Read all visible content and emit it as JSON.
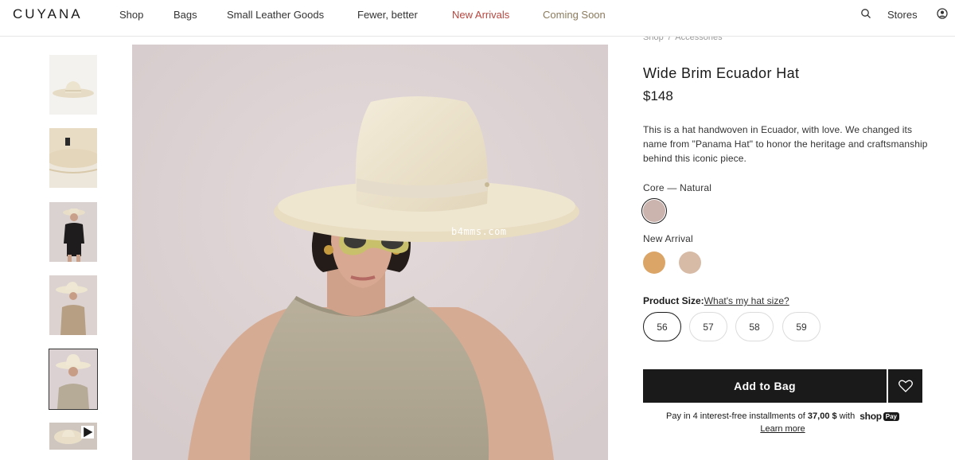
{
  "header": {
    "logo": "CUYANA",
    "nav": [
      "Shop",
      "Bags",
      "Small Leather Goods",
      "Fewer, better",
      "New Arrivals",
      "Coming Soon"
    ],
    "stores": "Stores"
  },
  "breadcrumb": [
    "Shop",
    "/",
    "Accessories"
  ],
  "product": {
    "title": "Wide Brim Ecuador Hat",
    "price": "$148",
    "description": "This is a hat handwoven in Ecuador, with love. We changed its name from \"Panama Hat\" to honor the heritage and craftsmanship behind this iconic piece.",
    "core_label": "Core — Natural",
    "new_arrival_label": "New Arrival",
    "swatches": {
      "core": [
        {
          "color": "#cbb3ae"
        }
      ],
      "new_arrival": [
        {
          "color": "#dba567"
        },
        {
          "color": "#d7bba6"
        }
      ]
    },
    "size_label": "Product Size:",
    "size_help": "What's my hat size?",
    "sizes": [
      "56",
      "57",
      "58",
      "59"
    ],
    "selected_size": "56",
    "add_to_bag": "Add to Bag"
  },
  "payment": {
    "prefix": "Pay in 4 interest-free installments of",
    "amount": "37,00 $",
    "with": "with",
    "brand": "shop",
    "badge": "Pay",
    "learn_more": "Learn more"
  },
  "watermark": "b4mms.com",
  "colors": {
    "text": "#1a1a1a",
    "new_arrivals": "#b5463f",
    "coming_soon": "#8a7a5c",
    "button": "#1a1a1a",
    "image_background": "#dcd1d2"
  }
}
